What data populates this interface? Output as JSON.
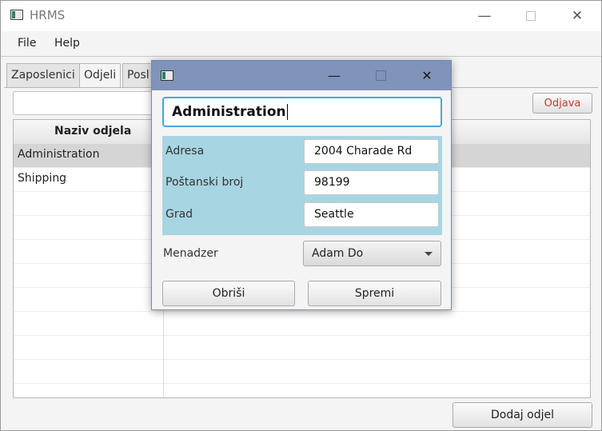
{
  "window": {
    "title": "HRMS"
  },
  "menu": {
    "items": [
      "File",
      "Help"
    ]
  },
  "tabs": [
    "Zaposlenici",
    "Odjeli",
    "Posl"
  ],
  "toolbar": {
    "logout_label": "Odjava",
    "search_value": ""
  },
  "table": {
    "columns": [
      "Naziv odjela"
    ],
    "rows": [
      "Administration",
      "Shipping"
    ]
  },
  "footer": {
    "add_label": "Dodaj odjel"
  },
  "dialog": {
    "name": "Administration",
    "address_label": "Adresa",
    "address_value": "2004 Charade Rd",
    "postal_label": "Poštanski broj",
    "postal_value": "98199",
    "city_label": "Grad",
    "city_value": "Seattle",
    "manager_label": "Menadzer",
    "manager_value": "Adam Do",
    "delete_label": "Obriši",
    "save_label": "Spremi"
  },
  "colors": {
    "dialog_titlebar": "#8093b9",
    "address_panel": "#a8d5e2",
    "focus_border": "#49a6d8",
    "logout_text": "#c0392b"
  },
  "icons": [
    "app-icon",
    "minimize-icon",
    "maximize-icon",
    "close-icon",
    "chevron-down-icon"
  ]
}
